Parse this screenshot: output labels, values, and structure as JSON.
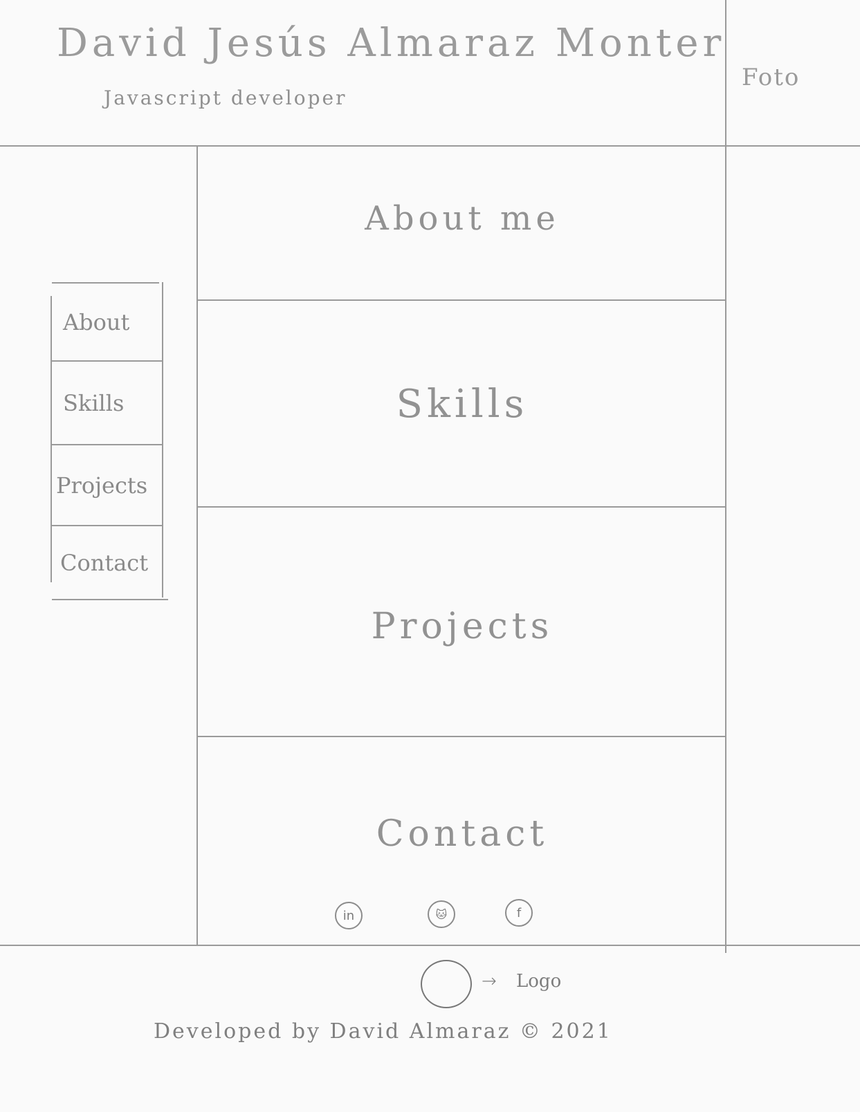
{
  "header": {
    "name": "David Jesús Almaraz Monter",
    "role": "Javascript developer",
    "photo_label": "Foto"
  },
  "nav": {
    "items": [
      {
        "label": "About"
      },
      {
        "label": "Skills"
      },
      {
        "label": "Projects"
      },
      {
        "label": "Contact"
      }
    ]
  },
  "sections": [
    {
      "title": "About me"
    },
    {
      "title": "Skills"
    },
    {
      "title": "Projects"
    },
    {
      "title": "Contact"
    }
  ],
  "social": [
    {
      "icon": "linkedin-icon",
      "glyph": "in"
    },
    {
      "icon": "github-icon",
      "glyph": "🐱"
    },
    {
      "icon": "facebook-icon",
      "glyph": "f"
    }
  ],
  "footer": {
    "logo_arrow": "→",
    "logo_label": "Logo",
    "credit": "Developed by David Almaraz © 2021"
  }
}
